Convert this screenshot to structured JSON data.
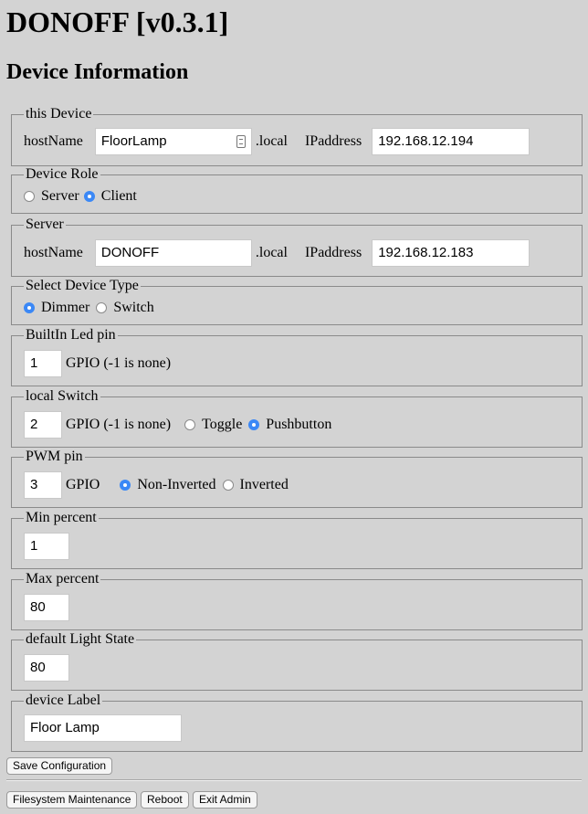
{
  "app": {
    "title": "DONOFF [v0.3.1]",
    "heading": "Device Information"
  },
  "this_device": {
    "legend": "this Device",
    "hostname_label": "hostName",
    "hostname_value": "FloorLamp",
    "local_suffix": ".local",
    "ip_label": "IPaddress",
    "ip_value": "192.168.12.194"
  },
  "device_role": {
    "legend": "Device Role",
    "options": [
      {
        "label": "Server",
        "selected": false
      },
      {
        "label": "Client",
        "selected": true
      }
    ]
  },
  "server": {
    "legend": "Server",
    "hostname_label": "hostName",
    "hostname_value": "DONOFF",
    "local_suffix": ".local",
    "ip_label": "IPaddress",
    "ip_value": "192.168.12.183"
  },
  "device_type": {
    "legend": "Select Device Type",
    "options": [
      {
        "label": "Dimmer",
        "selected": true
      },
      {
        "label": "Switch",
        "selected": false
      }
    ]
  },
  "builtin_led": {
    "legend": "BuiltIn Led pin",
    "value": "1",
    "suffix": "GPIO (-1 is none)"
  },
  "local_switch": {
    "legend": "local Switch",
    "value": "2",
    "suffix": "GPIO (-1 is none)",
    "options": [
      {
        "label": "Toggle",
        "selected": false
      },
      {
        "label": "Pushbutton",
        "selected": true
      }
    ]
  },
  "pwm_pin": {
    "legend": "PWM pin",
    "value": "3",
    "suffix": "GPIO",
    "options": [
      {
        "label": "Non-Inverted",
        "selected": true
      },
      {
        "label": "Inverted",
        "selected": false
      }
    ]
  },
  "min_percent": {
    "legend": "Min percent",
    "value": "1"
  },
  "max_percent": {
    "legend": "Max percent",
    "value": "80"
  },
  "default_light_state": {
    "legend": "default Light State",
    "value": "80"
  },
  "device_label": {
    "legend": "device Label",
    "value": "Floor Lamp"
  },
  "buttons": {
    "save": "Save Configuration",
    "filesystem": "Filesystem Maintenance",
    "reboot": "Reboot",
    "exit": "Exit Admin"
  },
  "colors": {
    "background": "#d3d3d3",
    "accent": "#3b88f6"
  }
}
